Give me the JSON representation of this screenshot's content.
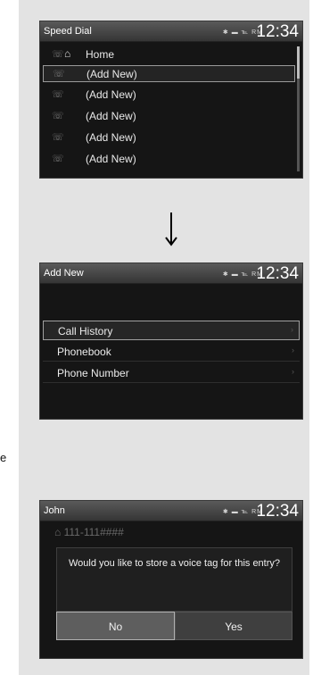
{
  "stray_text": "e",
  "screen1": {
    "title": "Speed Dial",
    "status_icons": "✱ ▬ ℡ RM",
    "time": "12:34",
    "items": [
      {
        "icon": "☏",
        "label": "Home"
      },
      {
        "icon": "☏",
        "label": "(Add New)"
      },
      {
        "icon": "☏",
        "label": "(Add New)"
      },
      {
        "icon": "☏",
        "label": "(Add New)"
      },
      {
        "icon": "☏",
        "label": "(Add New)"
      },
      {
        "icon": "☏",
        "label": "(Add New)"
      }
    ],
    "home_icon": "⌂"
  },
  "screen2": {
    "title": "Add New",
    "status_icons": "✱ ▬ ℡ RM",
    "time": "12:34",
    "menu": [
      {
        "label": "Call History",
        "chevron": "›"
      },
      {
        "label": "Phonebook",
        "chevron": "›"
      },
      {
        "label": "Phone Number",
        "chevron": "›"
      }
    ]
  },
  "screen3": {
    "title": "John",
    "status_icons": "✱ ▬ ℡ RM",
    "time": "12:34",
    "home_icon": "⌂",
    "number": "111-111####",
    "message": "Would you like to store a voice tag for this entry?",
    "no_label": "No",
    "yes_label": "Yes"
  }
}
